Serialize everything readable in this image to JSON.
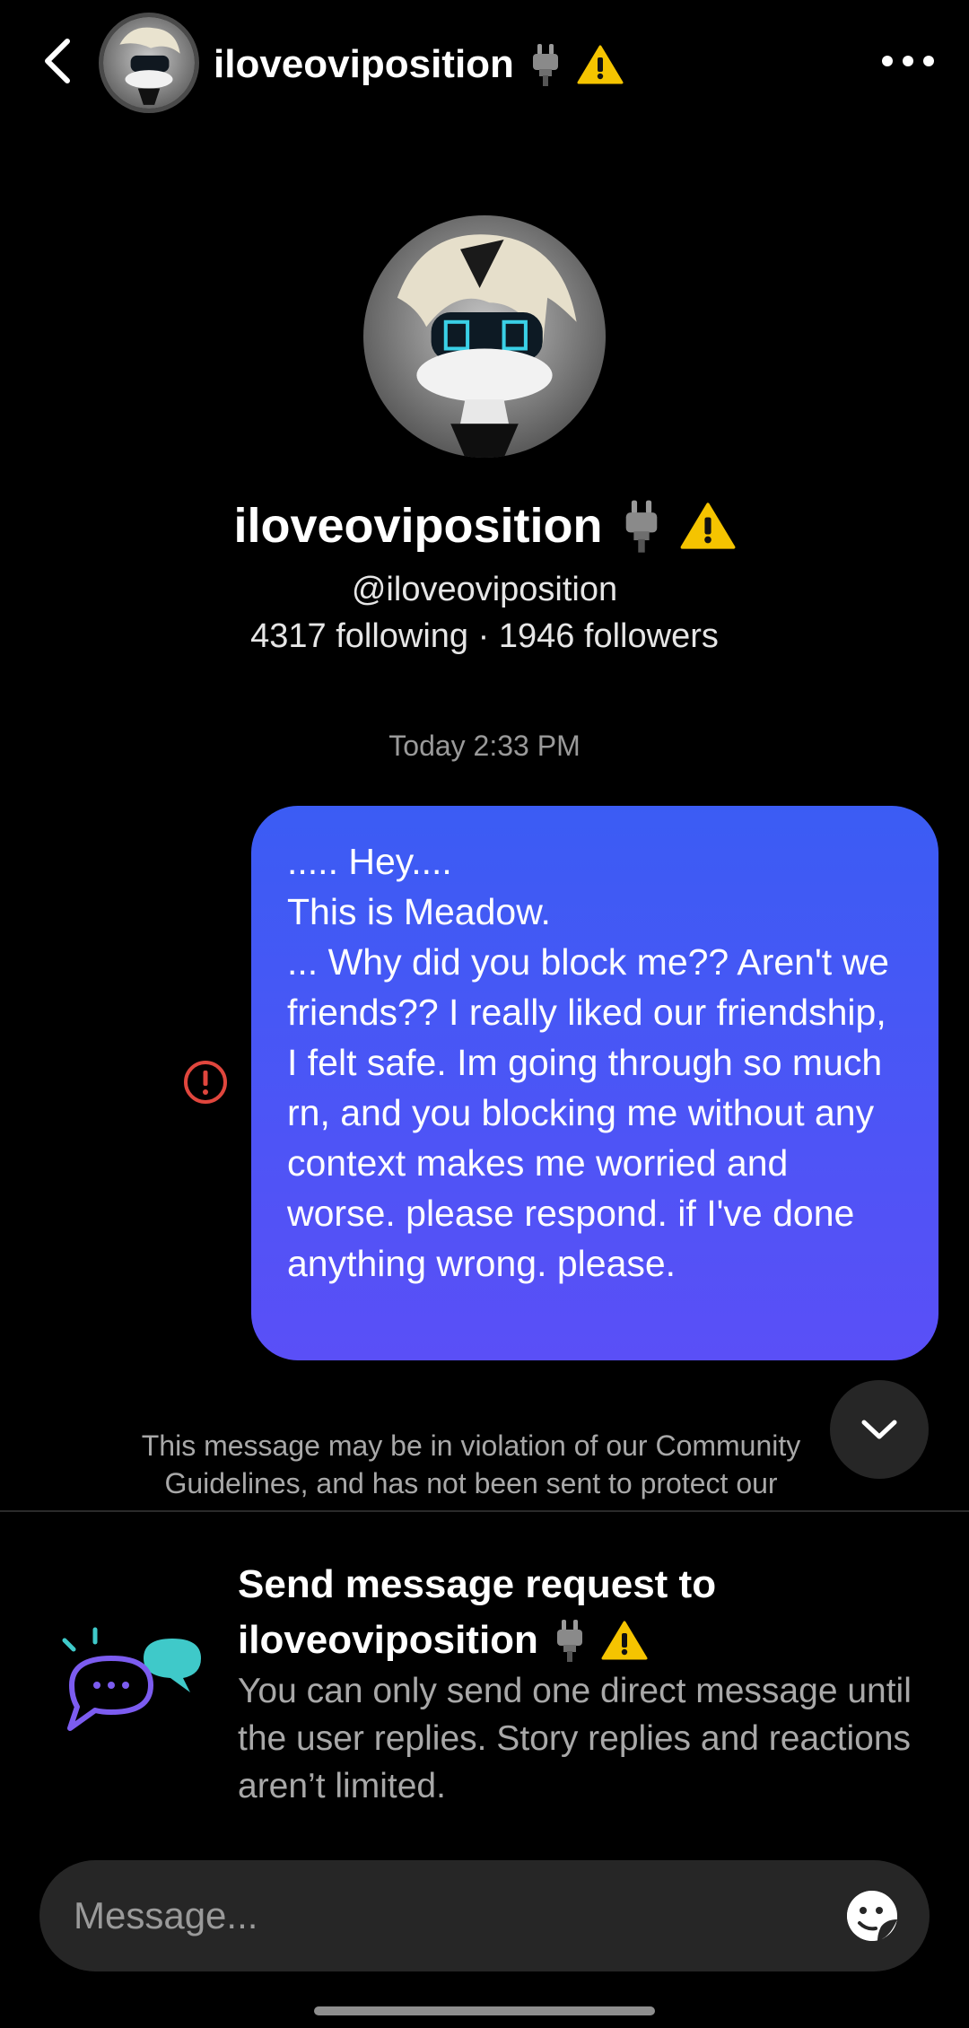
{
  "header": {
    "username": "iloveoviposition",
    "icons": [
      "back-chevron-icon",
      "plug-icon",
      "warning-icon",
      "more-icon"
    ]
  },
  "profile": {
    "display_name": "iloveoviposition",
    "handle": "@iloveoviposition",
    "stats": "4317 following · 1946 followers"
  },
  "thread": {
    "timestamp": "Today 2:33 PM",
    "message": "..... Hey....\nThis is Meadow.\n... Why did you block me?? Aren't we friends?? I really liked our friendship, I felt safe. Im going through so much rn, and you blocking me without any context makes me worried and worse. please respond. if I've done anything wrong. please.",
    "violation_notice": "This message may be in violation of our Community Guidelines, and has not been sent to protect our community. If"
  },
  "request": {
    "title_line1": "Send message request to",
    "title_name": "iloveoviposition",
    "description": "You can only send one direct message until the user replies. Story replies and reactions aren’t limited."
  },
  "composer": {
    "placeholder": "Message..."
  },
  "colors": {
    "bubble_top": "#3b5cf4",
    "bubble_bottom": "#5a4ff7",
    "error_red": "#e0463d",
    "warning_yellow": "#f5c400"
  }
}
